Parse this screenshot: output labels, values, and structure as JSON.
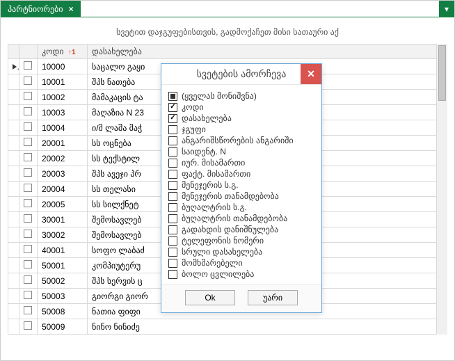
{
  "tab": {
    "label": "პარტნიორები",
    "close": "×",
    "dropdown": "▾"
  },
  "group_hint": "სვეტით დაჯგუფებისთვის, გადმოქაჩეთ მისი სათაური აქ",
  "columns": {
    "code": "კოდი",
    "sort_indicator": "1",
    "name": "დასახელება"
  },
  "rows": [
    {
      "code": "10000",
      "name": "საცალო გაყი",
      "current": true
    },
    {
      "code": "10001",
      "name": "შპს ნათება"
    },
    {
      "code": "10002",
      "name": "მამაკაცის ტა"
    },
    {
      "code": "10003",
      "name": "მაღაზია N 23"
    },
    {
      "code": "10004",
      "name": "ი/მ ლაშა მაჭ"
    },
    {
      "code": "20001",
      "name": "სს ოცნება"
    },
    {
      "code": "20002",
      "name": "სს ტექსტილ"
    },
    {
      "code": "20003",
      "name": "შპს ავეჯი პრ"
    },
    {
      "code": "20004",
      "name": "სს თელასი"
    },
    {
      "code": "20005",
      "name": "სს სილქნეტ"
    },
    {
      "code": "30001",
      "name": "შემოსავლებ"
    },
    {
      "code": "30002",
      "name": "შემოსავლებ"
    },
    {
      "code": "40001",
      "name": "სოფო ლაბაძ"
    },
    {
      "code": "50001",
      "name": "კომპიუტერუ"
    },
    {
      "code": "50002",
      "name": "შპს სერვის ც"
    },
    {
      "code": "50003",
      "name": "გიორგი გიორ"
    },
    {
      "code": "50008",
      "name": "ნათია ფიფი"
    },
    {
      "code": "50009",
      "name": "ნინო ნინიძე"
    }
  ],
  "dialog": {
    "title": "სვეტების ამორჩევა",
    "close": "✕",
    "items": [
      {
        "label": "(ყველას მონიშვნა)",
        "state": "indeterminate"
      },
      {
        "label": "კოდი",
        "state": "checked"
      },
      {
        "label": "დასახელება",
        "state": "checked"
      },
      {
        "label": "ჯგუფი",
        "state": "unchecked"
      },
      {
        "label": "ანგარიშსწორების ანგარიში",
        "state": "unchecked"
      },
      {
        "label": "საიდენტ. N",
        "state": "unchecked"
      },
      {
        "label": "იურ. მისამართი",
        "state": "unchecked"
      },
      {
        "label": "ფაქტ. მისამართი",
        "state": "unchecked"
      },
      {
        "label": "მენეჯერის ს.გ.",
        "state": "unchecked"
      },
      {
        "label": "მენეჯერის თანამდებობა",
        "state": "unchecked"
      },
      {
        "label": "ბუღალტრის ს.გ.",
        "state": "unchecked"
      },
      {
        "label": "ბუღალტრის თანამდებობა",
        "state": "unchecked"
      },
      {
        "label": "გადახდის დანიშნულება",
        "state": "unchecked"
      },
      {
        "label": "ტელეფონის ნომერი",
        "state": "unchecked"
      },
      {
        "label": "სრული დასახელება",
        "state": "unchecked"
      },
      {
        "label": "მომხმარებელი",
        "state": "unchecked"
      },
      {
        "label": "ბოლო ცვლილება",
        "state": "unchecked"
      }
    ],
    "ok": "Ok",
    "cancel": "უარი"
  }
}
